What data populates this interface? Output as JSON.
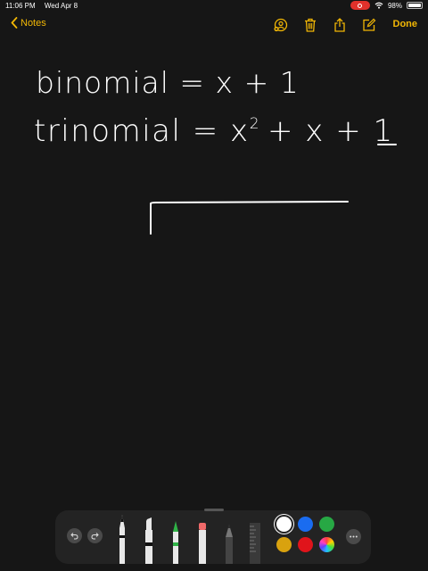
{
  "status_bar": {
    "time": "11:06 PM",
    "date": "Wed Apr 8",
    "battery_percent": "98%",
    "battery_level": 0.98
  },
  "nav": {
    "back_label": "Notes",
    "done_label": "Done",
    "accent_color": "#f2b705",
    "icons": [
      "add-person-icon",
      "trash-icon",
      "share-icon",
      "compose-icon"
    ]
  },
  "note": {
    "line1": "binomial = x + 1",
    "line2_before_exponent": "trinomial = x",
    "line2_exponent": "2",
    "line2_after_exponent": "+ x + 1",
    "ink_color": "#ffffff"
  },
  "toolbar": {
    "tools": [
      "pen",
      "highlighter",
      "marker",
      "eraser",
      "pencil",
      "ruler"
    ],
    "colors": [
      "#ffffff",
      "#1a6cf0",
      "#27a844",
      "#d9a20f",
      "#e0141b",
      "color-wheel"
    ],
    "selected_color": "#ffffff"
  }
}
